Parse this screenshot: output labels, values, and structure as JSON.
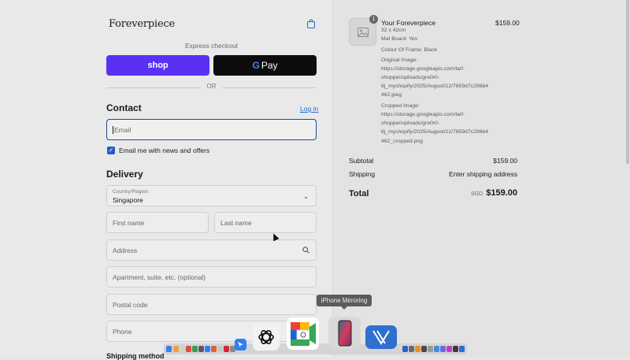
{
  "header": {
    "logo": "Foreverpiece"
  },
  "express": {
    "label": "Express checkout",
    "shop_label": "shop",
    "gpay_g": "G",
    "gpay_label": "Pay",
    "or": "OR"
  },
  "contact": {
    "heading": "Contact",
    "login": "Log in",
    "email_placeholder": "Email",
    "newsletter_label": "Email me with news and offers",
    "newsletter_checked": true
  },
  "delivery": {
    "heading": "Delivery",
    "country_label": "Country/Region",
    "country_value": "Singapore",
    "first_name": "First name",
    "last_name": "Last name",
    "address": "Address",
    "apartment": "Apartment, suite, etc. (optional)",
    "postal": "Postal code",
    "phone": "Phone",
    "shipping_method": "Shipping method"
  },
  "order": {
    "quantity": "1",
    "product_name": "Your Foreverpiece",
    "product_price": "$159.00",
    "lines": [
      "32 x 42cm",
      "Mat Board: Yes",
      "Colour Of Frame: Black",
      "Original Image:",
      "https://storage.googleapis.com/larf-",
      "shopper/uploads/gre0r0-",
      "6j_myshopify/2025/August/12/7659d7c296b4",
      "462.jpeg",
      "Cropped Image:",
      "https://storage.googleapis.com/larf-",
      "shopper/uploads/gre0r0-",
      "6j_myshopify/2025/August/12/7659d7c296b4",
      "462_cropped.png"
    ],
    "subtotal_label": "Subtotal",
    "subtotal_value": "$159.00",
    "shipping_label": "Shipping",
    "shipping_value": "Enter shipping address",
    "total_label": "Total",
    "currency": "SGD",
    "total_value": "$159.00"
  },
  "dock": {
    "tooltip": "iPhone Mirroring"
  },
  "colors": {
    "shop": "#5a31f4",
    "gpay": "#0d0d0d",
    "link": "#1c6ad1",
    "focus": "#1c4d8c"
  }
}
